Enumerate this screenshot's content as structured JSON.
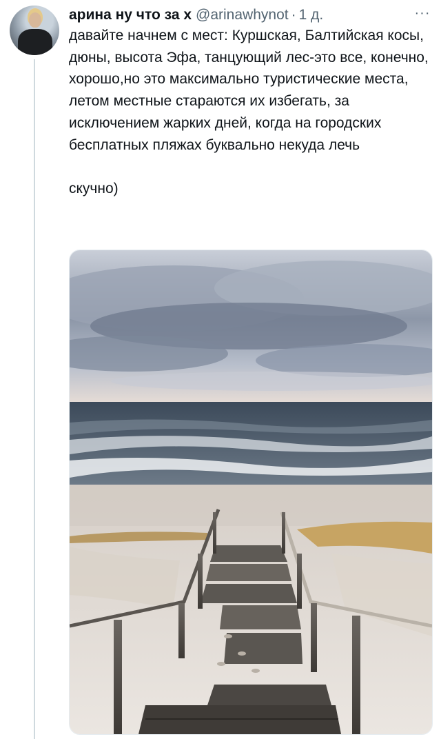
{
  "tweet": {
    "author_name": "арина ну что за х",
    "handle": "@arinawhynot",
    "separator": "·",
    "timestamp": "1 д.",
    "more_label": "···",
    "text_paragraph_1": "давайте начнем с мест: Куршская, Балтийская косы, дюны, высота Эфа, танцующий лес-это все, конечно, хорошо,но это максимально туристические места, летом местные стараются их избегать, за исключением жарких дней, когда на городских бесплатных пляжах буквально некуда лечь",
    "text_paragraph_2": "скучно)"
  },
  "media": {
    "icon": "photo-beach-stairs",
    "colors": {
      "sky_top": "#c7ccd6",
      "cloud": "#7d889c",
      "sea": "#4a5868",
      "foam": "#e8ecef",
      "sand": "#e2dcd4",
      "grass": "#c7a463",
      "wood": "#4e4a46"
    }
  }
}
